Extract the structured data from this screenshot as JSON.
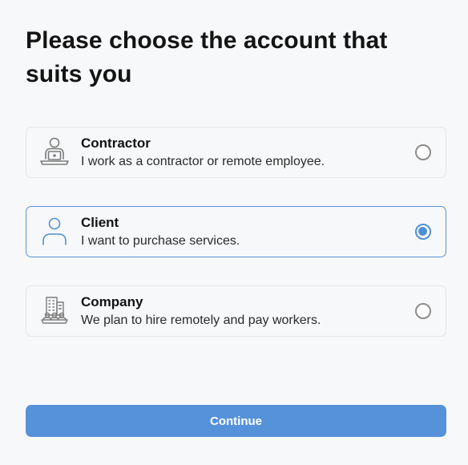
{
  "page": {
    "title": "Please choose the account that suits you"
  },
  "options": [
    {
      "id": "contractor",
      "title": "Contractor",
      "description": "I work as a contractor or remote employee.",
      "icon": "laptop-worker-icon",
      "selected": false
    },
    {
      "id": "client",
      "title": "Client",
      "description": "I want to purchase services.",
      "icon": "person-icon",
      "selected": true
    },
    {
      "id": "company",
      "title": "Company",
      "description": "We plan to hire remotely and pay workers.",
      "icon": "office-building-team-icon",
      "selected": false
    }
  ],
  "actions": {
    "continue_label": "Continue"
  },
  "colors": {
    "accent": "#5592da",
    "selected_border": "#5a93d6",
    "icon_gray": "#7a7a7a",
    "icon_blue": "#4f8fd8",
    "background": "#f7f8f9"
  }
}
